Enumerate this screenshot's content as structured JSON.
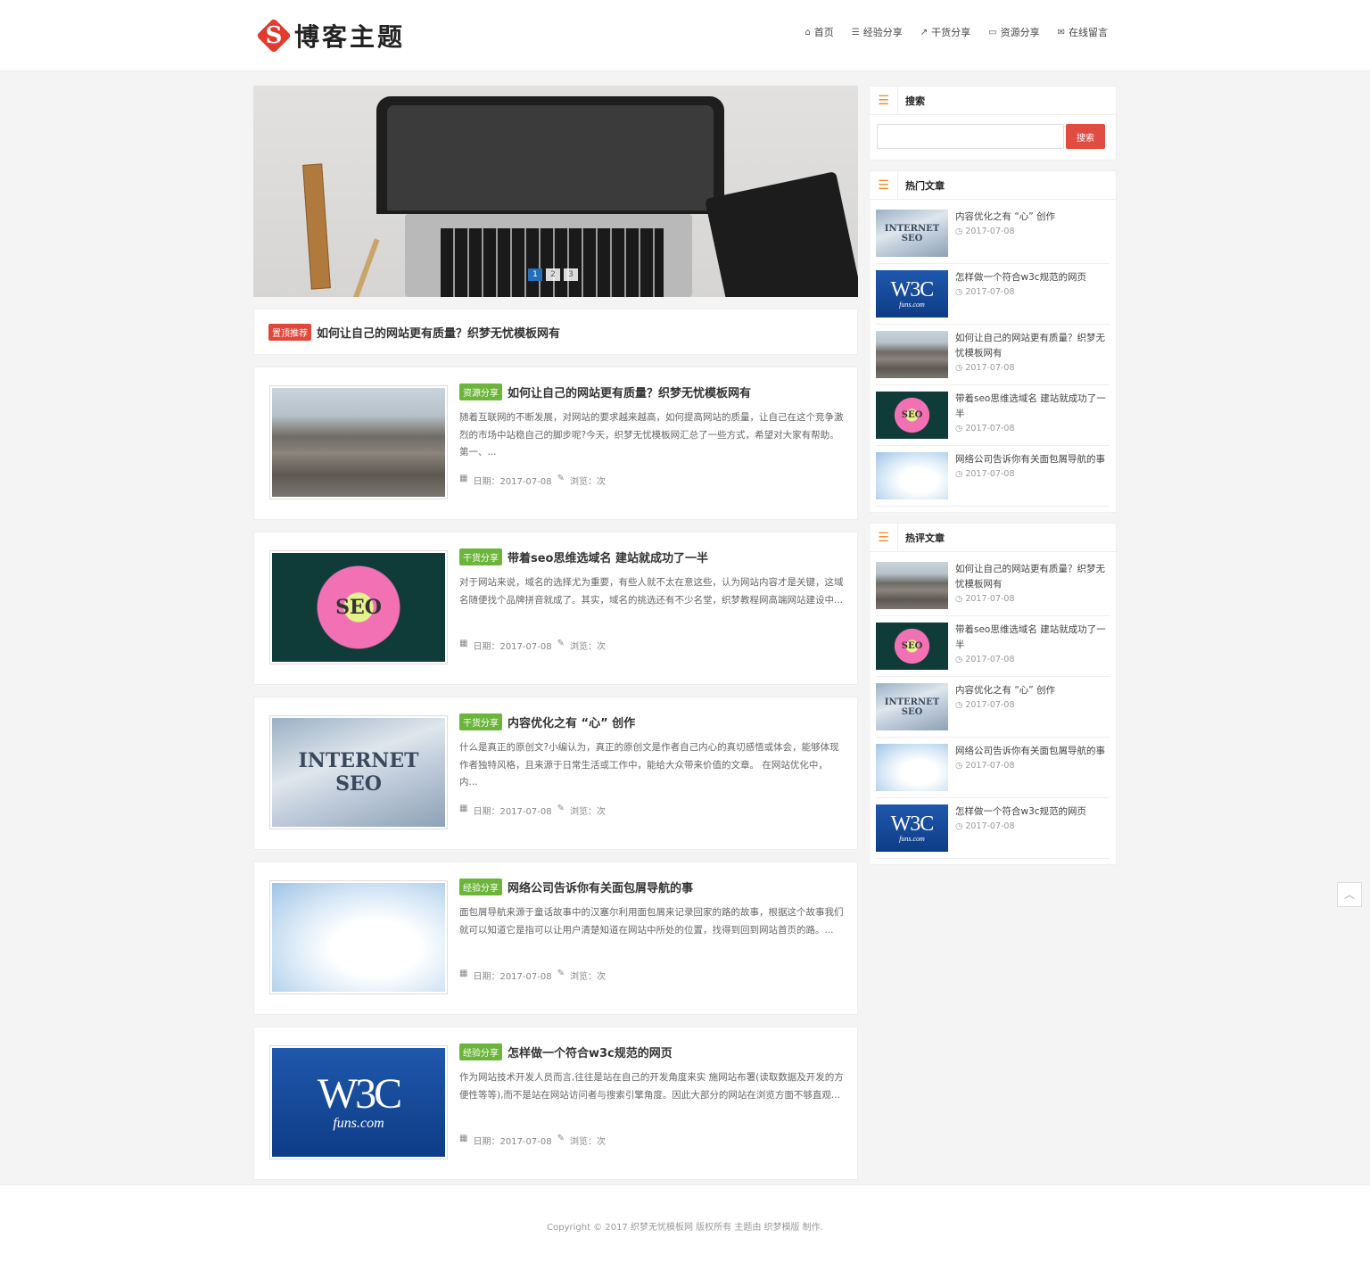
{
  "header": {
    "logo_mark": "S",
    "logo_text": "博客主题",
    "nav": [
      {
        "label": "首页",
        "icon": "home-icon",
        "glyph": "⌂"
      },
      {
        "label": "经验分享",
        "icon": "list-icon",
        "glyph": "☰"
      },
      {
        "label": "干货分享",
        "icon": "share-icon",
        "glyph": "↗"
      },
      {
        "label": "资源分享",
        "icon": "desktop-icon",
        "glyph": "▭"
      },
      {
        "label": "在线留言",
        "icon": "comments-icon",
        "glyph": "✉"
      }
    ]
  },
  "slider": {
    "dots": [
      "1",
      "2",
      "3"
    ],
    "active": 1
  },
  "sticky": {
    "badge": "置顶推荐",
    "title": "如何让自己的网站更有质量？织梦无忧模板网有"
  },
  "posts": [
    {
      "badge": "资源分享",
      "title": "如何让自己的网站更有质量？织梦无忧模板网有",
      "excerpt": "随着互联网的不断发展，对网站的要求越来越高，如何提高网站的质量，让自己在这个竞争激烈的市场中站稳自己的脚步呢?今天，织梦无忧模板网汇总了一些方式，希望对大家有帮助。 第一、...",
      "date": "日期：2017-07-08",
      "views": "浏览：次"
    },
    {
      "badge": "干货分享",
      "title": "带着seo思维选域名 建站就成功了一半",
      "excerpt": "对于网站来说，域名的选择尤为重要，有些人就不太在意这些，认为网站内容才是关键，这域名随便找个品牌拼音就成了。其实，域名的挑选还有不少名堂，织梦教程网高端网站建设中...",
      "date": "日期：2017-07-08",
      "views": "浏览：次"
    },
    {
      "badge": "干货分享",
      "title": "内容优化之有 “心” 创作",
      "excerpt": "什么是真正的原创文?小编认为，真正的原创文是作者自己内心的真切感悟或体会，能够体现作者独特风格，且来源于日常生活或工作中，能给大众带来价值的文章。 在网站优化中，内...",
      "date": "日期：2017-07-08",
      "views": "浏览：次"
    },
    {
      "badge": "经验分享",
      "title": "网络公司告诉你有关面包屑导航的事",
      "excerpt": "面包屑导航来源于童话故事中的汉塞尔利用面包屑来记录回家的路的故事，根据这个故事我们就可以知道它是指可以让用户清楚知道在网站中所处的位置，找得到回到网站首页的路。...",
      "date": "日期：2017-07-08",
      "views": "浏览：次"
    },
    {
      "badge": "经验分享",
      "title": "怎样做一个符合w3c规范的网页",
      "excerpt": "作为网站技术开发人员而言,往往是站在自己的开发角度来实 施网站布署(读取数据及开发的方便性等等),而不是站在网站访问者与搜索引擎角度。因此大部分的网站在浏览方面不够直观...",
      "date": "日期：2017-07-08",
      "views": "浏览：次"
    }
  ],
  "sidebar": {
    "search": {
      "title": "搜索",
      "button": "搜索",
      "placeholder": ""
    },
    "hot": {
      "title": "热门文章",
      "items": [
        {
          "title": "内容优化之有 “心” 创作",
          "date": "2017-07-08"
        },
        {
          "title": "怎样做一个符合w3c规范的网页",
          "date": "2017-07-08"
        },
        {
          "title": "如何让自己的网站更有质量？织梦无忧模板网有",
          "date": "2017-07-08"
        },
        {
          "title": "带着seo思维选域名 建站就成功了一半",
          "date": "2017-07-08"
        },
        {
          "title": "网络公司告诉你有关面包屑导航的事",
          "date": "2017-07-08"
        }
      ]
    },
    "comment": {
      "title": "热评文章",
      "items": [
        {
          "title": "如何让自己的网站更有质量？织梦无忧模板网有",
          "date": "2017-07-08"
        },
        {
          "title": "带着seo思维选域名 建站就成功了一半",
          "date": "2017-07-08"
        },
        {
          "title": "内容优化之有 “心” 创作",
          "date": "2017-07-08"
        },
        {
          "title": "网络公司告诉你有关面包屑导航的事",
          "date": "2017-07-08"
        },
        {
          "title": "怎样做一个符合w3c规范的网页",
          "date": "2017-07-08"
        }
      ]
    }
  },
  "images": {
    "seo": "SEO",
    "internet": "INTERNET",
    "w3c": "W3C",
    "w3c_sub": "funs.com"
  },
  "footer": {
    "copyright": "Copyright © 2017 织梦无忧模板网 版权所有 主题由 织梦模版 制作."
  },
  "gotop": {
    "glyph": "︿"
  }
}
